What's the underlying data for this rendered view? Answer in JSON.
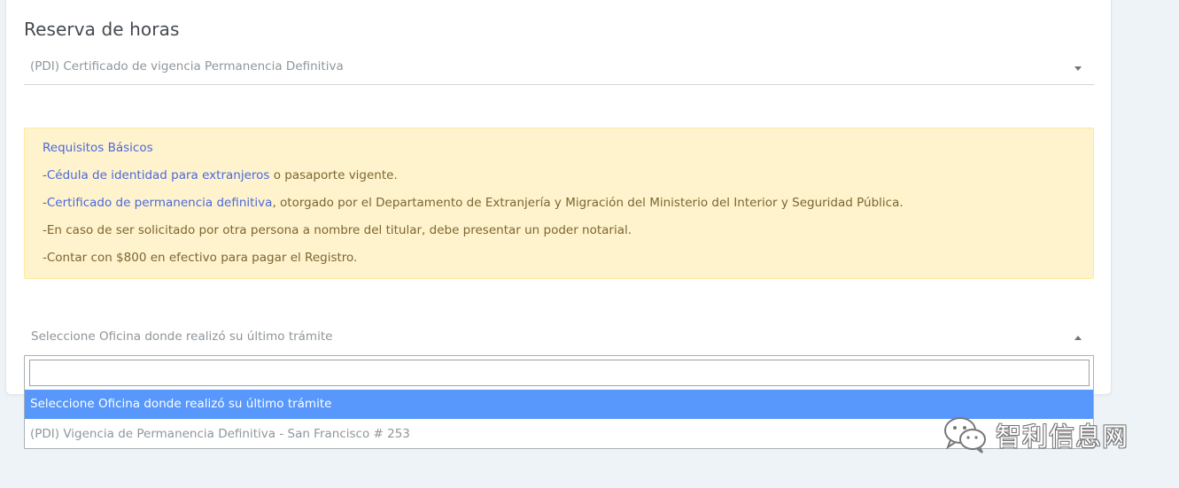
{
  "page": {
    "title": "Reserva de horas"
  },
  "tramite_select": {
    "value": "(PDI) Certificado de vigencia Permanencia Definitiva"
  },
  "requirements": {
    "header": "Requisitos Básicos",
    "items": [
      {
        "prefix": "-",
        "link": "Cédula de identidad para extranjeros",
        "text": " o pasaporte vigente."
      },
      {
        "prefix": "-",
        "link": "Certificado de permanencia definitiva",
        "text": ", otorgado por el Departamento de Extranjería y Migración del Ministerio del Interior y Seguridad Pública."
      },
      {
        "prefix": "-",
        "link": "",
        "text": "En caso de ser solicitado por otra persona a nombre del titular, debe presentar un poder notarial."
      },
      {
        "prefix": "-",
        "link": "",
        "text": "Contar con $800 en efectivo para pagar el Registro."
      }
    ]
  },
  "office_select": {
    "value": "Seleccione Oficina donde realizó su último trámite",
    "search_value": "",
    "options": [
      "Seleccione Oficina donde realizó su último trámite",
      "(PDI) Vigencia de Permanencia Definitiva - San Francisco # 253"
    ]
  },
  "watermark": {
    "text": "智利信息网",
    "icon": "wechat-icon"
  },
  "colors": {
    "background": "#edf3f6",
    "alert_bg": "#fff3cd",
    "link": "#4a68dc",
    "highlight": "#5897fb"
  }
}
